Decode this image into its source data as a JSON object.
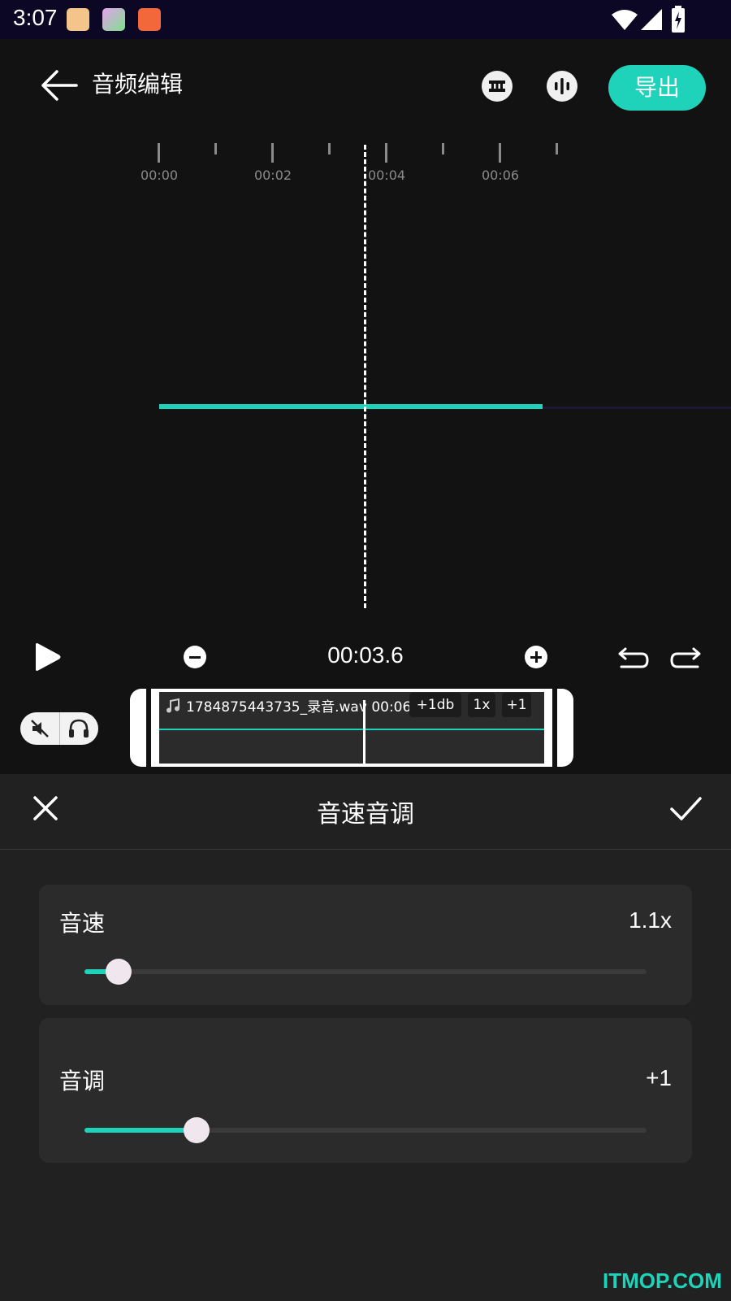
{
  "status_bar": {
    "time": "3:07"
  },
  "header": {
    "title": "音频编辑",
    "export_label": "导出"
  },
  "timeline": {
    "tick_labels": [
      "00:00",
      "00:02",
      "00:04",
      "00:06"
    ],
    "current_time": "00:03.6"
  },
  "clip": {
    "name": "1784875443735_录音.wav",
    "duration": "00:06",
    "volume": "+1db",
    "speed": "1x",
    "pitch": "+1"
  },
  "panel": {
    "title": "音速音调",
    "speed": {
      "label": "音速",
      "value": "1.1x",
      "fraction": 0.06
    },
    "pitch": {
      "label": "音调",
      "value": "+1",
      "fraction": 0.2
    }
  },
  "watermark": "ITMOP.COM",
  "colors": {
    "accent": "#1ed3b9",
    "background": "#121212",
    "panel": "#212121"
  }
}
